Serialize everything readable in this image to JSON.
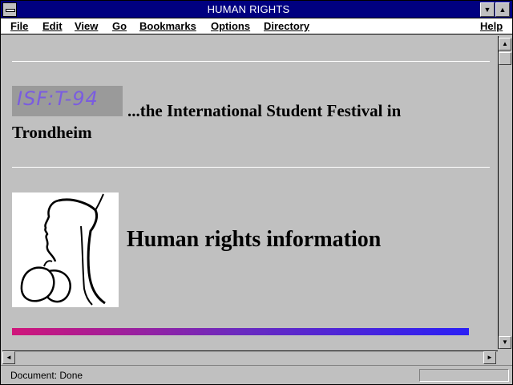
{
  "window": {
    "title": "HUMAN RIGHTS",
    "min_glyph": "▼",
    "max_glyph": "▲"
  },
  "menu": {
    "items": [
      {
        "label": "File"
      },
      {
        "label": "Edit"
      },
      {
        "label": "View"
      },
      {
        "label": "Go"
      },
      {
        "label": "Bookmarks"
      },
      {
        "label": "Options"
      },
      {
        "label": "Directory"
      },
      {
        "label": "Help"
      }
    ]
  },
  "page": {
    "logo_text": "ISF:T-94",
    "festival_text": "...the International Student Festival in Trondheim",
    "heading": "Human rights information"
  },
  "scroll": {
    "up_glyph": "▲",
    "down_glyph": "▼",
    "left_glyph": "◄",
    "right_glyph": "►"
  },
  "status": {
    "text": "Document: Done"
  },
  "colors": {
    "titlebar": "#000080",
    "gradient_start": "#d0157a",
    "gradient_end": "#2a1ff5",
    "logo_text": "#7a5ce0"
  },
  "icons": {
    "system_menu": "system-menu-icon",
    "minimize": "minimize-icon",
    "maximize": "maximize-icon"
  }
}
